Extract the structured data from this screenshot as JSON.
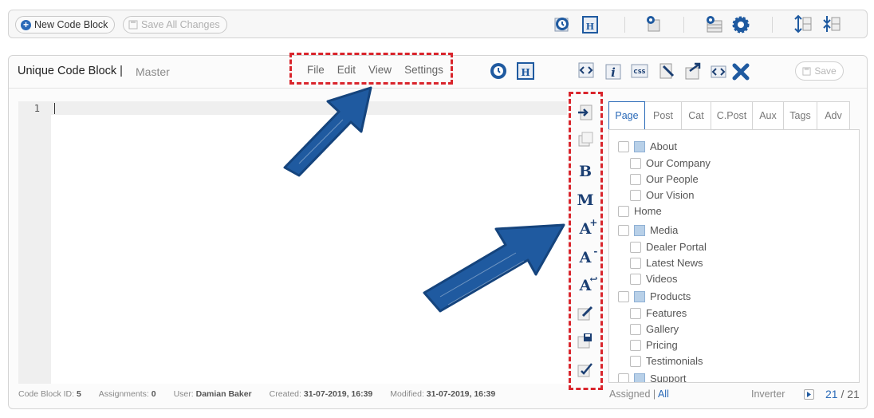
{
  "toolbar": {
    "new_label": "New Code Block",
    "save_all_label": "Save All Changes",
    "icons": [
      "history-icon",
      "html-icon",
      "settings-page-icon",
      "settings-grid-icon",
      "gear-icon",
      "expand-rows-icon",
      "collapse-rows-icon"
    ]
  },
  "block": {
    "title": "Unique Code Block",
    "separator": "|",
    "subtitle": "Master",
    "menu": [
      "File",
      "Edit",
      "View",
      "Settings"
    ],
    "save_label": "Save",
    "header_icons": [
      "history-icon",
      "html-icon",
      "code-icon",
      "info-icon",
      "css-icon",
      "edit-file-icon",
      "export-icon",
      "code-wrap-icon",
      "close-icon"
    ]
  },
  "editor": {
    "line_numbers": [
      "1"
    ]
  },
  "side_tools": {
    "letters": [
      "B",
      "M",
      "A",
      "A",
      "A"
    ],
    "letter_marks": [
      "",
      "",
      "+",
      "-",
      "↩"
    ]
  },
  "tabs": [
    "Page",
    "Post",
    "Cat",
    "C.Post",
    "Aux",
    "Tags",
    "Adv"
  ],
  "tree": [
    {
      "label": "About",
      "level": 0,
      "folder": true
    },
    {
      "label": "Our Company",
      "level": 1,
      "folder": false
    },
    {
      "label": "Our People",
      "level": 1,
      "folder": false
    },
    {
      "label": "Our Vision",
      "level": 1,
      "folder": false
    },
    {
      "label": "Home",
      "level": 0,
      "folder": false
    },
    {
      "label": "Media",
      "level": 0,
      "folder": true
    },
    {
      "label": "Dealer Portal",
      "level": 1,
      "folder": false
    },
    {
      "label": "Latest News",
      "level": 1,
      "folder": false
    },
    {
      "label": "Videos",
      "level": 1,
      "folder": false
    },
    {
      "label": "Products",
      "level": 0,
      "folder": true
    },
    {
      "label": "Features",
      "level": 1,
      "folder": false
    },
    {
      "label": "Gallery",
      "level": 1,
      "folder": false
    },
    {
      "label": "Pricing",
      "level": 1,
      "folder": false
    },
    {
      "label": "Testimonials",
      "level": 1,
      "folder": false
    },
    {
      "label": "Support",
      "level": 0,
      "folder": true
    }
  ],
  "footer": {
    "id_label": "Code Block ID:",
    "id_value": "5",
    "assign_label": "Assignments:",
    "assign_value": "0",
    "user_label": "User:",
    "user_value": "Damian Baker",
    "created_label": "Created:",
    "created_value": "31-07-2019, 16:39",
    "modified_label": "Modified:",
    "modified_value": "31-07-2019, 16:39",
    "assigned_label": "Assigned",
    "assigned_sep": "|",
    "all_label": "All",
    "inverter_label": "Inverter",
    "count_current": "21",
    "count_sep": "/",
    "count_total": "21"
  },
  "colors": {
    "accent": "#2a6ab8",
    "highlight_box": "#d9252c",
    "arrow": "#1f5aa0"
  }
}
